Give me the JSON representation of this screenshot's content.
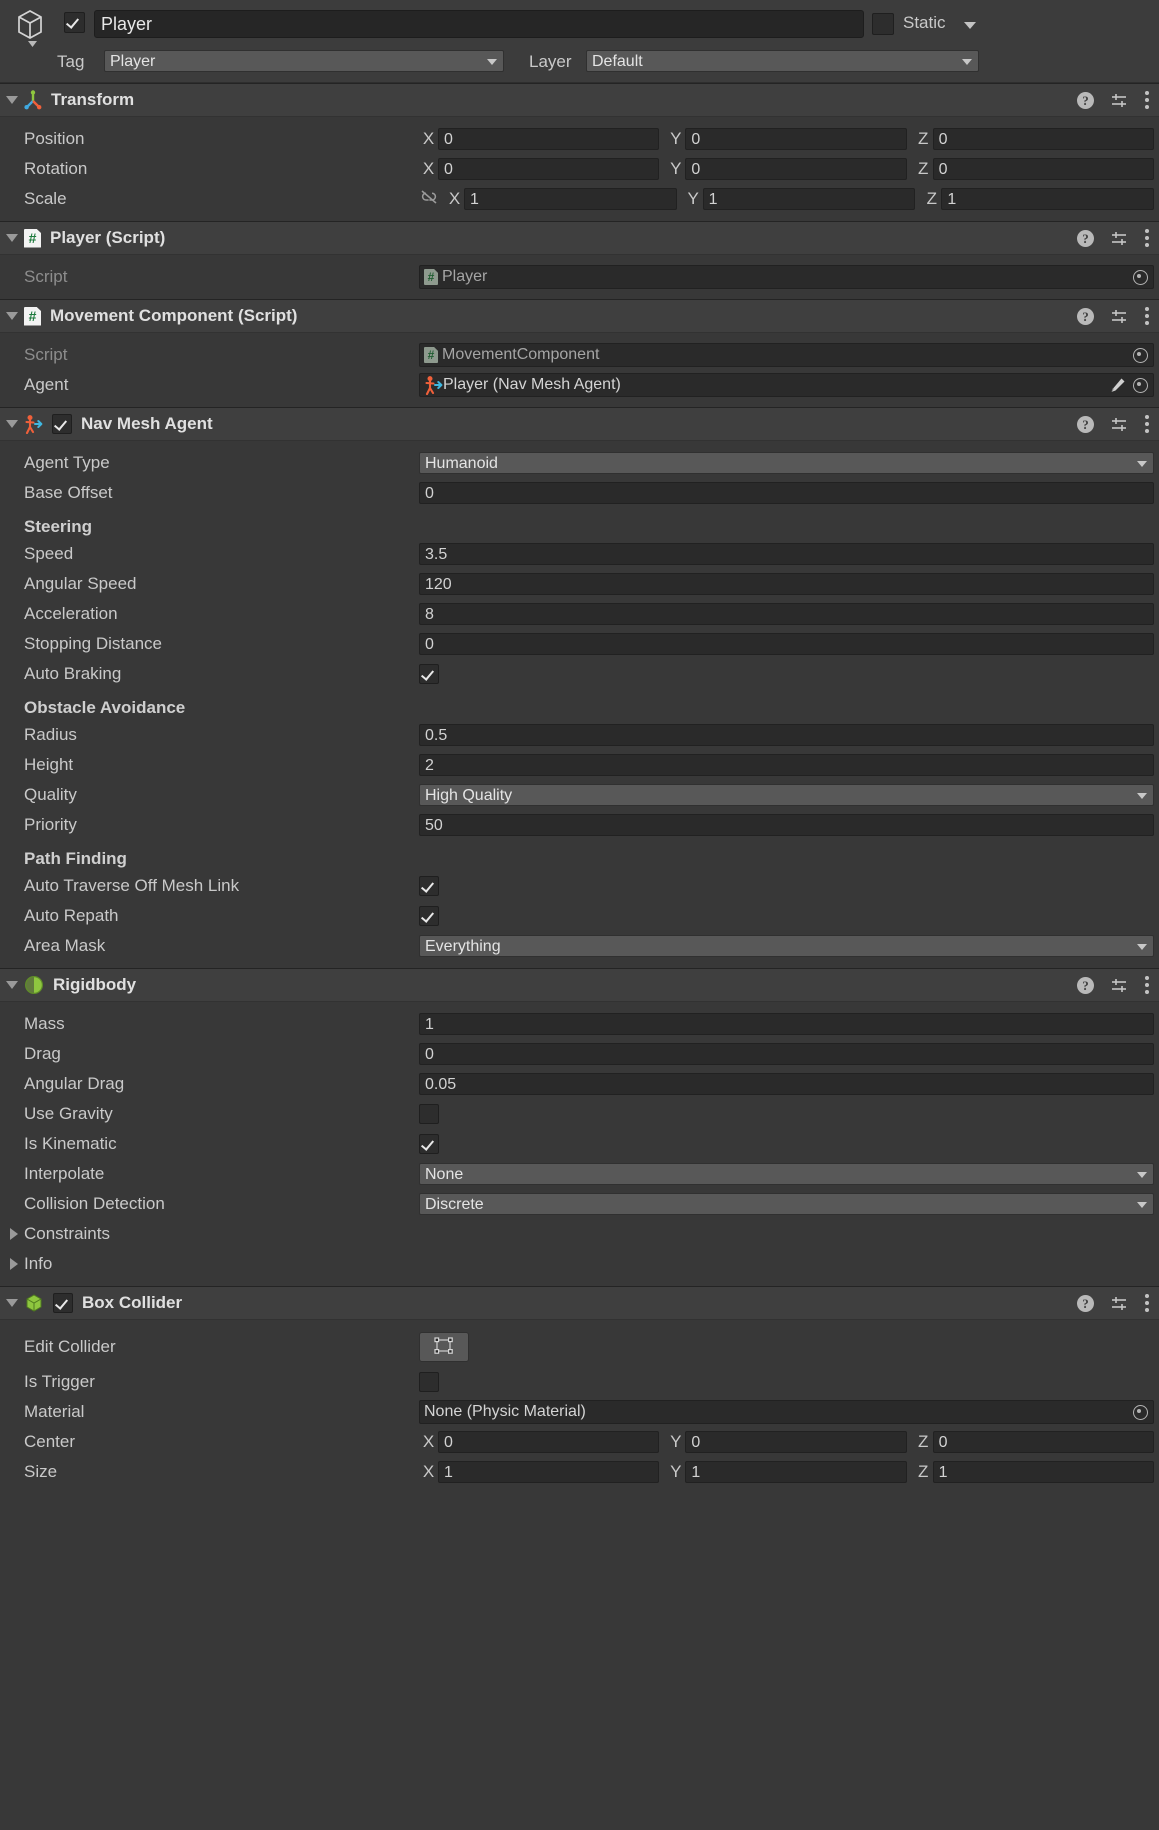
{
  "object_header": {
    "icon": "cube-prefab-icon",
    "enabled": true,
    "name": "Player",
    "static_label": "Static",
    "static_checked": false,
    "tag_label": "Tag",
    "tag_value": "Player",
    "layer_label": "Layer",
    "layer_value": "Default"
  },
  "header_icons": {
    "help": "?",
    "preset": "preset-icon",
    "menu": "kebab-menu-icon"
  },
  "components": [
    {
      "name": "Transform",
      "icon": "transform-axis-icon",
      "has_checkbox": false,
      "expanded": true,
      "rows": [
        {
          "type": "vector3",
          "label": "Position",
          "x": "0",
          "y": "0",
          "z": "0",
          "axes": [
            "X",
            "Y",
            "Z"
          ],
          "link": false
        },
        {
          "type": "vector3",
          "label": "Rotation",
          "x": "0",
          "y": "0",
          "z": "0",
          "axes": [
            "X",
            "Y",
            "Z"
          ],
          "link": false
        },
        {
          "type": "vector3",
          "label": "Scale",
          "x": "1",
          "y": "1",
          "z": "1",
          "axes": [
            "X",
            "Y",
            "Z"
          ],
          "link": true
        }
      ]
    },
    {
      "name": "Player (Script)",
      "icon": "script-icon",
      "has_checkbox": false,
      "expanded": true,
      "rows": [
        {
          "type": "object",
          "label": "Script",
          "label_dim": true,
          "value": "Player",
          "value_icon": "script-asset-icon",
          "picker": true,
          "pencil": false,
          "readonly": true
        }
      ]
    },
    {
      "name": "Movement Component (Script)",
      "icon": "script-icon",
      "has_checkbox": false,
      "expanded": true,
      "rows": [
        {
          "type": "object",
          "label": "Script",
          "label_dim": true,
          "value": "MovementComponent",
          "value_icon": "script-asset-icon",
          "picker": true,
          "pencil": false,
          "readonly": true
        },
        {
          "type": "object",
          "label": "Agent",
          "label_dim": false,
          "value": "Player (Nav Mesh Agent)",
          "value_icon": "nav-mesh-agent-icon",
          "picker": true,
          "pencil": true,
          "readonly": false
        }
      ]
    },
    {
      "name": "Nav Mesh Agent",
      "icon": "nav-mesh-agent-icon",
      "has_checkbox": true,
      "checked": true,
      "expanded": true,
      "rows": [
        {
          "type": "popup",
          "label": "Agent Type",
          "value": "Humanoid"
        },
        {
          "type": "number",
          "label": "Base Offset",
          "value": "0"
        },
        {
          "type": "subhead",
          "label": "Steering"
        },
        {
          "type": "number",
          "label": "Speed",
          "value": "3.5"
        },
        {
          "type": "number",
          "label": "Angular Speed",
          "value": "120"
        },
        {
          "type": "number",
          "label": "Acceleration",
          "value": "8"
        },
        {
          "type": "number",
          "label": "Stopping Distance",
          "value": "0"
        },
        {
          "type": "checkbox",
          "label": "Auto Braking",
          "checked": true
        },
        {
          "type": "subhead",
          "label": "Obstacle Avoidance"
        },
        {
          "type": "number",
          "label": "Radius",
          "value": "0.5"
        },
        {
          "type": "number",
          "label": "Height",
          "value": "2"
        },
        {
          "type": "popup",
          "label": "Quality",
          "value": "High Quality"
        },
        {
          "type": "number",
          "label": "Priority",
          "value": "50"
        },
        {
          "type": "subhead",
          "label": "Path Finding"
        },
        {
          "type": "checkbox",
          "label": "Auto Traverse Off Mesh Link",
          "checked": true
        },
        {
          "type": "checkbox",
          "label": "Auto Repath",
          "checked": true
        },
        {
          "type": "popup",
          "label": "Area Mask",
          "value": "Everything"
        }
      ]
    },
    {
      "name": "Rigidbody",
      "icon": "rigidbody-icon",
      "has_checkbox": false,
      "expanded": true,
      "rows": [
        {
          "type": "number",
          "label": "Mass",
          "value": "1"
        },
        {
          "type": "number",
          "label": "Drag",
          "value": "0"
        },
        {
          "type": "number",
          "label": "Angular Drag",
          "value": "0.05"
        },
        {
          "type": "checkbox",
          "label": "Use Gravity",
          "checked": false
        },
        {
          "type": "checkbox",
          "label": "Is Kinematic",
          "checked": true
        },
        {
          "type": "popup",
          "label": "Interpolate",
          "value": "None"
        },
        {
          "type": "popup",
          "label": "Collision Detection",
          "value": "Discrete"
        },
        {
          "type": "foldout",
          "label": "Constraints",
          "expanded": false
        },
        {
          "type": "foldout",
          "label": "Info",
          "expanded": false
        }
      ]
    },
    {
      "name": "Box Collider",
      "icon": "box-collider-icon",
      "has_checkbox": true,
      "checked": true,
      "expanded": true,
      "rows": [
        {
          "type": "editcollider",
          "label": "Edit Collider",
          "button_icon": "edit-collider-icon"
        },
        {
          "type": "checkbox",
          "label": "Is Trigger",
          "checked": false
        },
        {
          "type": "object",
          "label": "Material",
          "label_dim": false,
          "value": "None (Physic Material)",
          "value_icon": "none",
          "picker": true,
          "pencil": false,
          "readonly": false
        },
        {
          "type": "vector3",
          "label": "Center",
          "x": "0",
          "y": "0",
          "z": "0",
          "axes": [
            "X",
            "Y",
            "Z"
          ],
          "link": false
        },
        {
          "type": "vector3",
          "label": "Size",
          "x": "1",
          "y": "1",
          "z": "1",
          "axes": [
            "X",
            "Y",
            "Z"
          ],
          "link": false
        }
      ]
    }
  ],
  "colors": {
    "panel_bg": "#383838",
    "header_bg": "#3f3f3f",
    "field_bg": "#2a2a2a",
    "popup_bg": "#585858",
    "text": "#c9c9c9",
    "accent_green": "#8ec63f",
    "accent_orange": "#f06a28",
    "accent_cyan": "#3fb7e0"
  }
}
